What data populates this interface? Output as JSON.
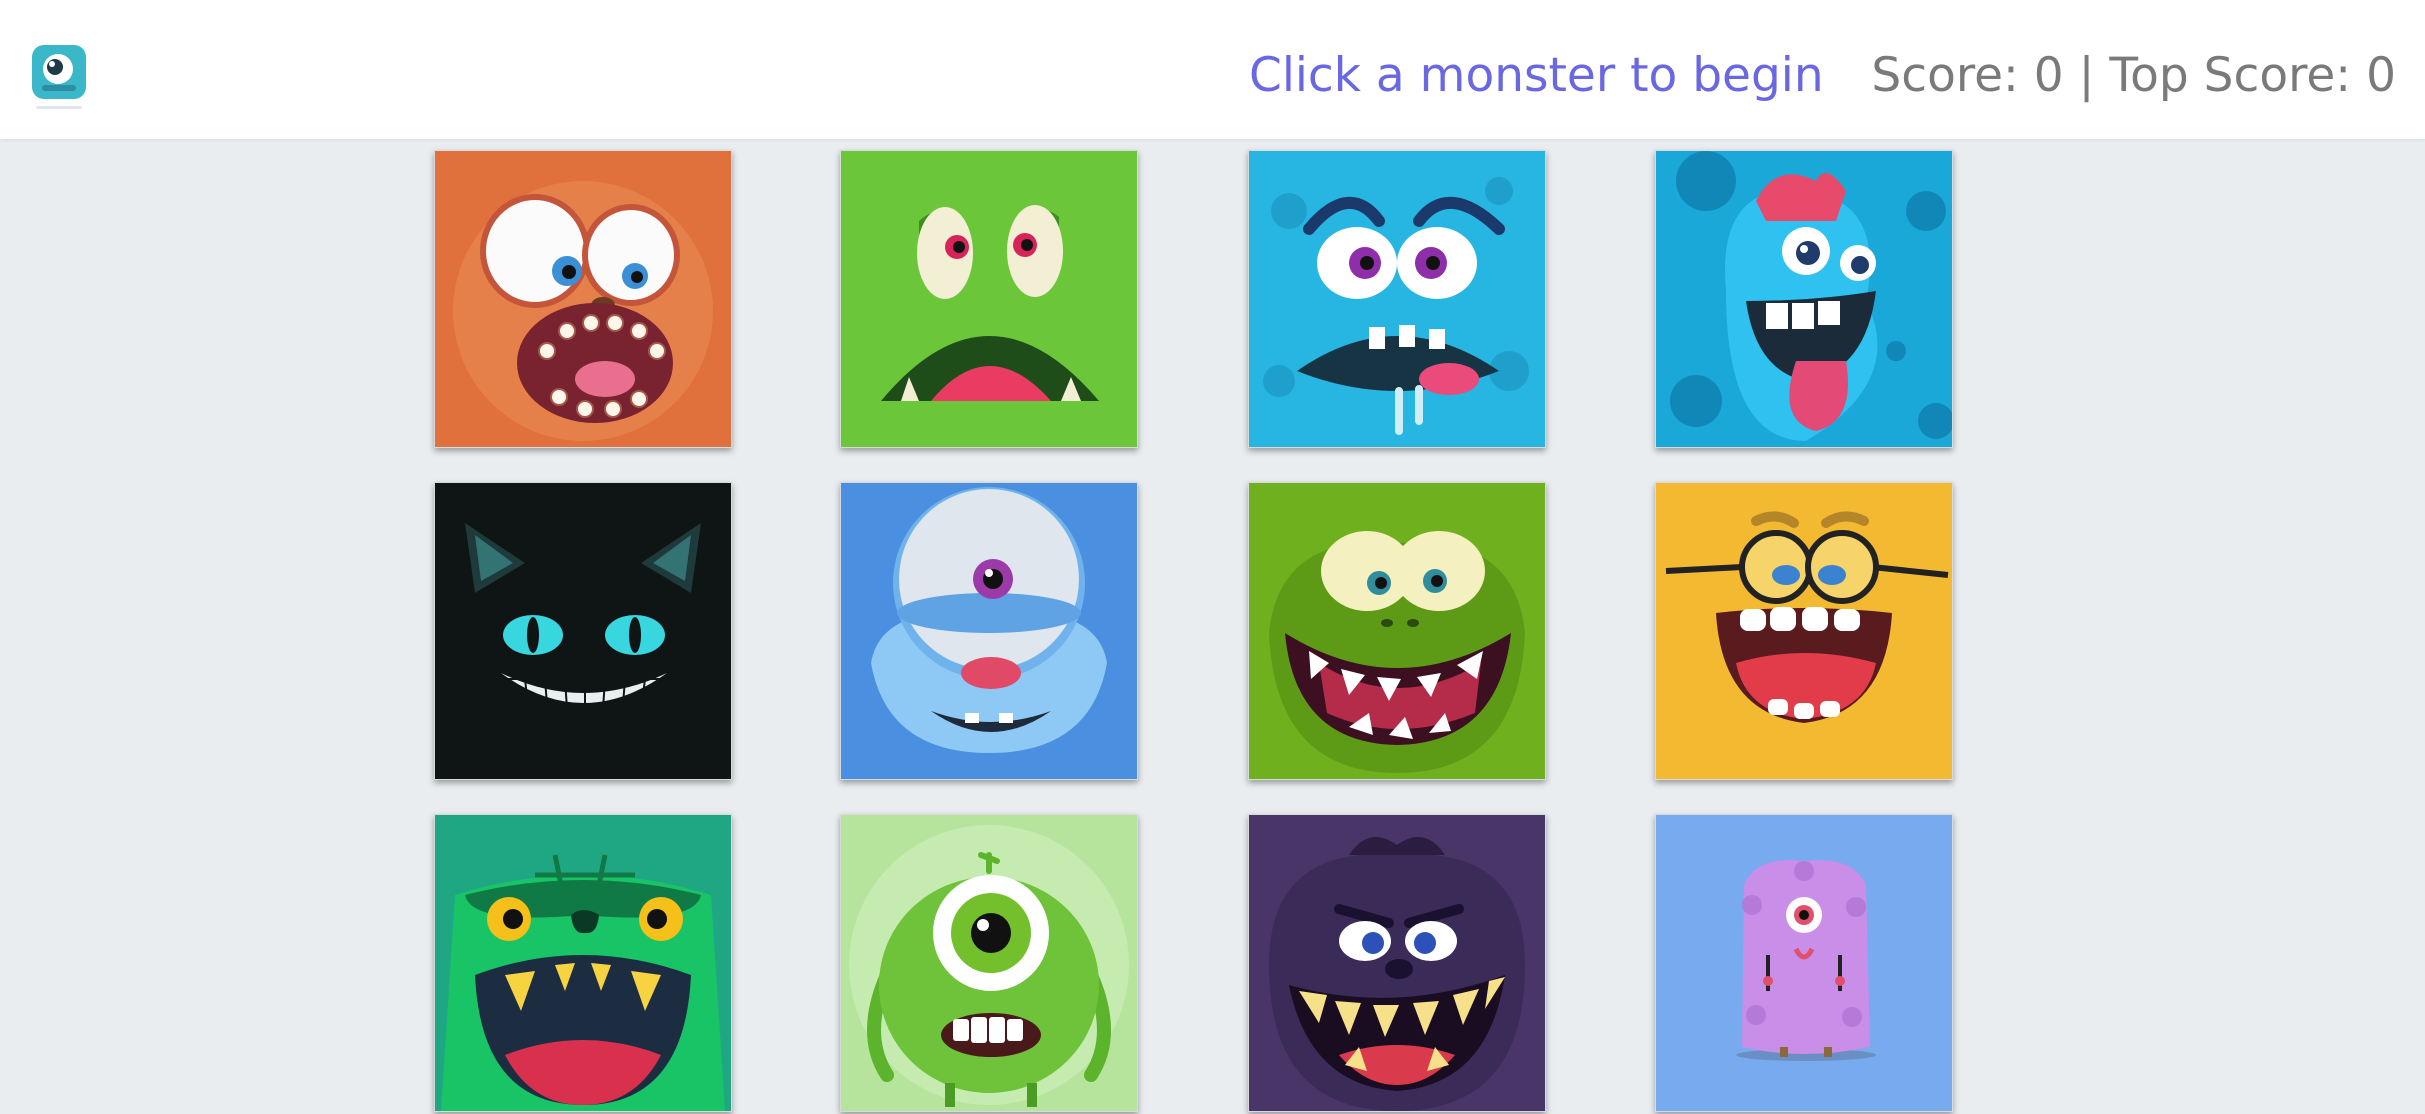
{
  "header": {
    "logo_icon": "monster-logo-icon",
    "status_text": "Click a monster to begin",
    "score_text": "Score: 0 | Top Score: 0"
  },
  "cards": [
    {
      "name": "orange-furry-monster-card",
      "icon": "orange-furry-monster-icon",
      "color": "#e0703c"
    },
    {
      "name": "green-gaping-monster-card",
      "icon": "green-gaping-monster-icon",
      "color": "#6bc63a"
    },
    {
      "name": "blue-scared-monster-card",
      "icon": "blue-scared-monster-icon",
      "color": "#27b6e2"
    },
    {
      "name": "blue-tongue-monster-card",
      "icon": "blue-tongue-monster-icon",
      "color": "#19a8d8"
    },
    {
      "name": "black-cat-monster-card",
      "icon": "black-cat-monster-icon",
      "color": "#0f1414"
    },
    {
      "name": "blue-cyclops-monster-card",
      "icon": "blue-cyclops-monster-icon",
      "color": "#4b8fe0"
    },
    {
      "name": "green-grinning-monster-card",
      "icon": "green-grinning-monster-icon",
      "color": "#6fb01e"
    },
    {
      "name": "yellow-glasses-monster-card",
      "icon": "yellow-glasses-monster-icon",
      "color": "#f3b931"
    },
    {
      "name": "teal-ogre-monster-card",
      "icon": "teal-ogre-monster-icon",
      "color": "#1fa784"
    },
    {
      "name": "green-one-eyed-monster-card",
      "icon": "green-one-eyed-monster-icon",
      "color": "#b6e49c"
    },
    {
      "name": "purple-angry-monster-card",
      "icon": "purple-angry-monster-icon",
      "color": "#4a3568"
    },
    {
      "name": "purple-fluffy-monster-card",
      "icon": "purple-fluffy-monster-icon",
      "color": "#78aaf0"
    }
  ]
}
